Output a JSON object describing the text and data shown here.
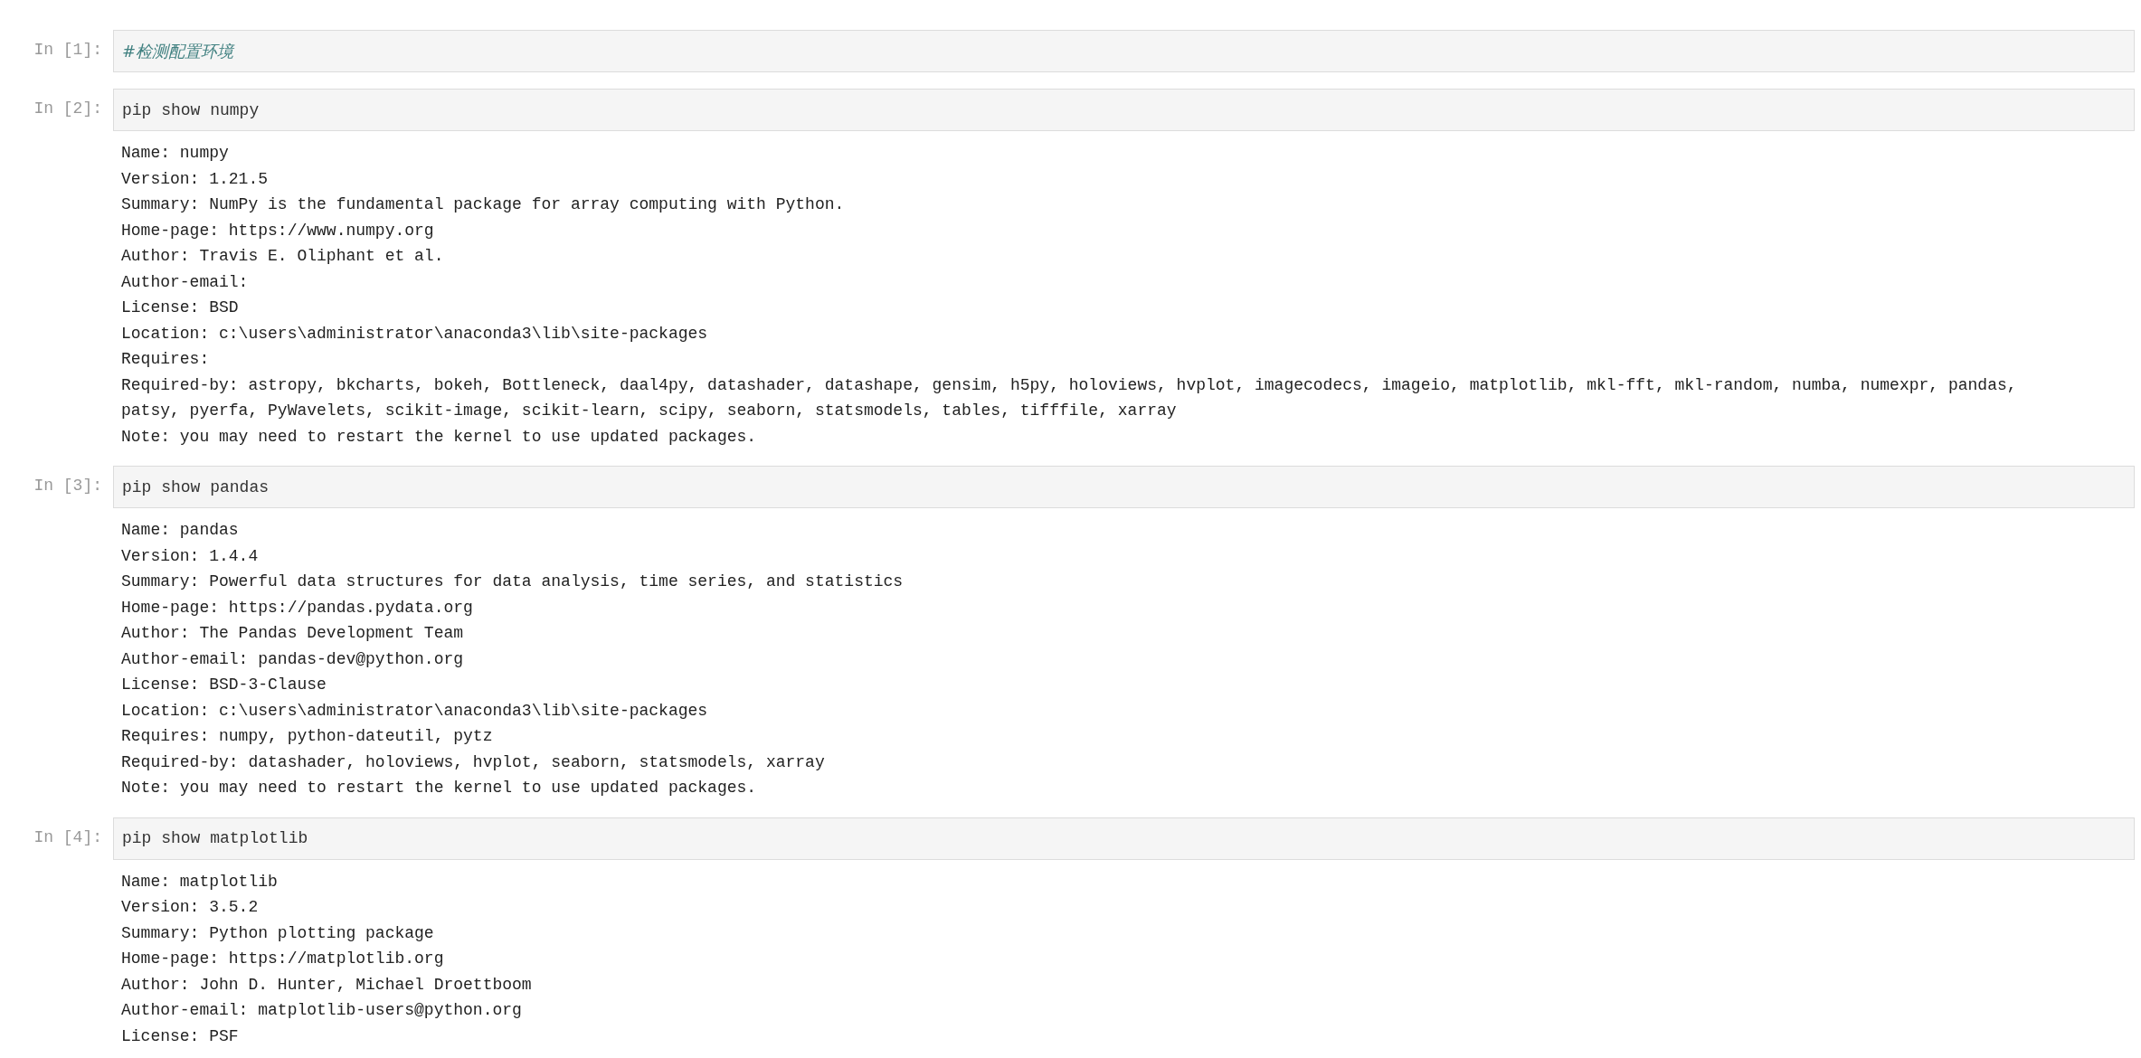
{
  "cells": [
    {
      "prompt": "In [1]:",
      "kind": "comment",
      "input": "#检测配置环境"
    },
    {
      "prompt": "In [2]:",
      "kind": "code",
      "input": "pip show numpy",
      "output": [
        "Name: numpy",
        "Version: 1.21.5",
        "Summary: NumPy is the fundamental package for array computing with Python.",
        "Home-page: https://www.numpy.org",
        "Author: Travis E. Oliphant et al.",
        "Author-email:",
        "License: BSD",
        "Location: c:\\users\\administrator\\anaconda3\\lib\\site-packages",
        "Requires:",
        "Required-by: astropy, bkcharts, bokeh, Bottleneck, daal4py, datashader, datashape, gensim, h5py, holoviews, hvplot, imagecodecs, imageio, matplotlib, mkl-fft, mkl-random, numba, numexpr, pandas,",
        "patsy, pyerfa, PyWavelets, scikit-image, scikit-learn, scipy, seaborn, statsmodels, tables, tifffile, xarray",
        "Note: you may need to restart the kernel to use updated packages."
      ]
    },
    {
      "prompt": "In [3]:",
      "kind": "code",
      "input": "pip show pandas",
      "output": [
        "Name: pandas",
        "Version: 1.4.4",
        "Summary: Powerful data structures for data analysis, time series, and statistics",
        "Home-page: https://pandas.pydata.org",
        "Author: The Pandas Development Team",
        "Author-email: pandas-dev@python.org",
        "License: BSD-3-Clause",
        "Location: c:\\users\\administrator\\anaconda3\\lib\\site-packages",
        "Requires: numpy, python-dateutil, pytz",
        "Required-by: datashader, holoviews, hvplot, seaborn, statsmodels, xarray",
        "Note: you may need to restart the kernel to use updated packages."
      ]
    },
    {
      "prompt": "In [4]:",
      "kind": "code",
      "input": "pip show matplotlib",
      "output": [
        "Name: matplotlib",
        "Version: 3.5.2",
        "Summary: Python plotting package",
        "Home-page: https://matplotlib.org",
        "Author: John D. Hunter, Michael Droettboom",
        "Author-email: matplotlib-users@python.org",
        "License: PSF"
      ]
    }
  ]
}
